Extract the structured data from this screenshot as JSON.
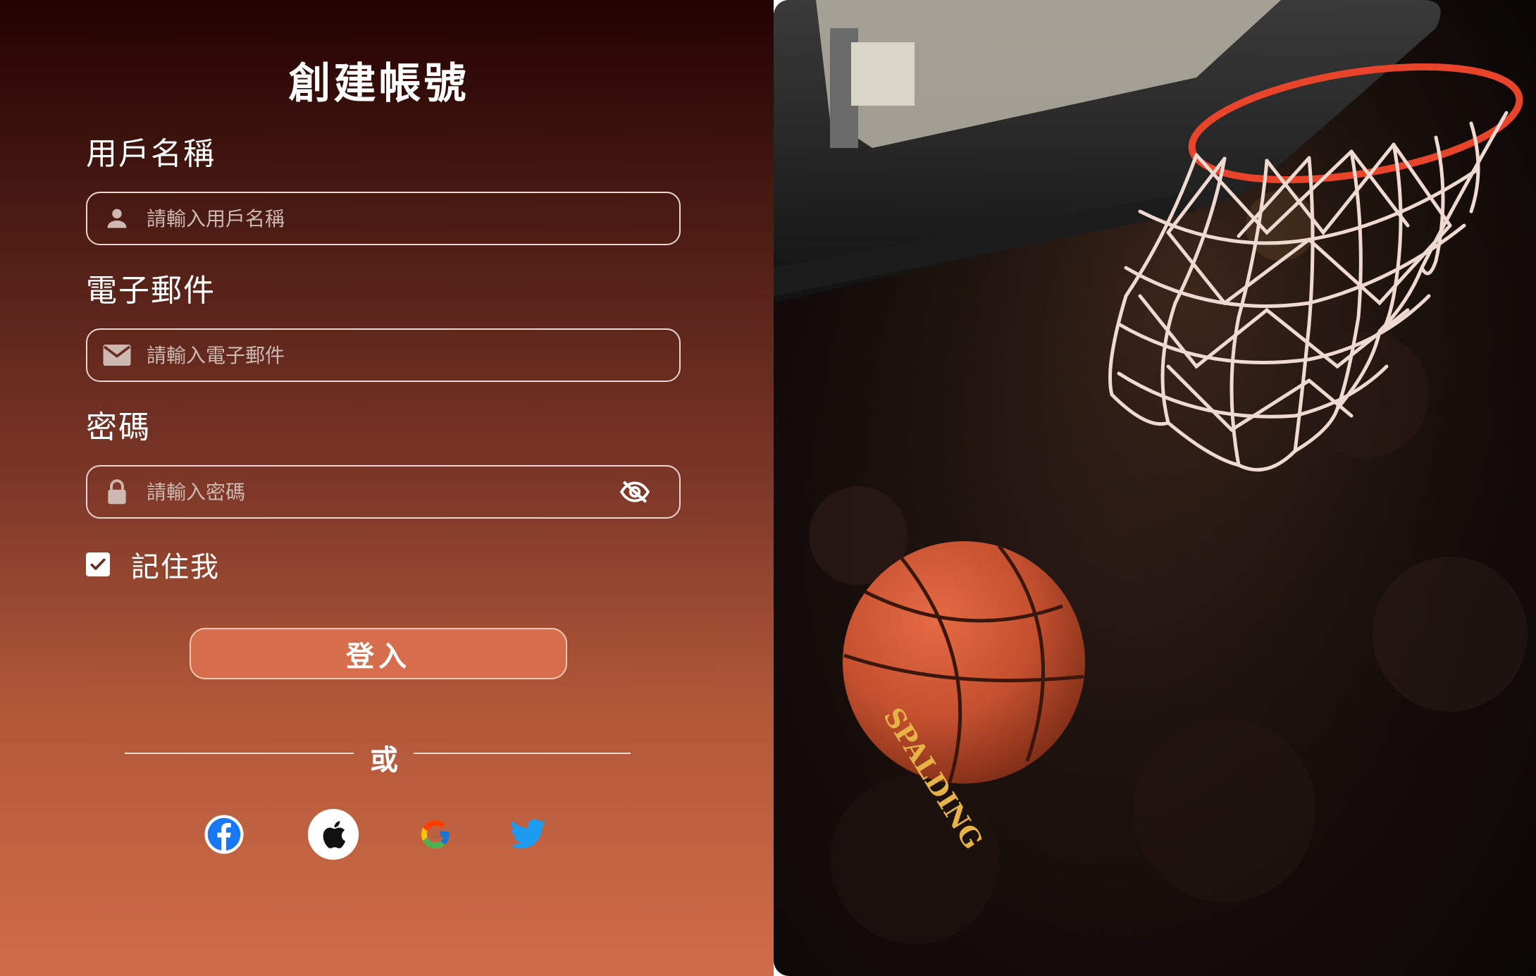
{
  "form": {
    "title": "創建帳號",
    "username": {
      "label": "用戶名稱",
      "placeholder": "請輸入用戶名稱",
      "icon": "person-icon"
    },
    "email": {
      "label": "電子郵件",
      "placeholder": "請輸入電子郵件",
      "icon": "envelope-icon"
    },
    "password": {
      "label": "密碼",
      "placeholder": "請輸入密碼",
      "icon": "lock-icon",
      "toggle_icon": "eye-slash-icon"
    },
    "remember": {
      "label": "記住我",
      "checked": true
    },
    "login_label": "登入",
    "divider_text": "或",
    "social": [
      {
        "name": "facebook",
        "icon": "facebook-icon"
      },
      {
        "name": "apple",
        "icon": "apple-icon"
      },
      {
        "name": "google",
        "icon": "google-icon"
      },
      {
        "name": "twitter",
        "icon": "twitter-icon"
      }
    ]
  },
  "colors": {
    "panel_top": "#230202",
    "panel_bottom": "#d06c49",
    "button_bg": "#d66d4d",
    "facebook": "#1877f2",
    "twitter": "#1d9bf0",
    "rim": "#e8432b",
    "ball": "#c4502f"
  },
  "photo": {
    "subject": "basketball-falling-through-hoop",
    "ball_text": "SPALDING"
  }
}
